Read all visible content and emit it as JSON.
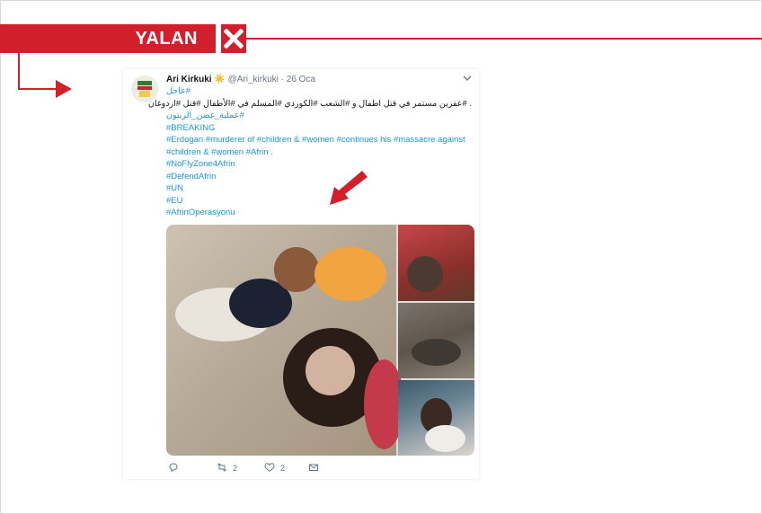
{
  "verdict": {
    "label": "YALAN",
    "icon": "close-icon",
    "color": "#d21f2c"
  },
  "tweet": {
    "author": {
      "display_name": "Ari Kirkuki",
      "emoji": "☀️",
      "handle": "@Ari_kirkuki",
      "separator": "·",
      "date": "26 Oca"
    },
    "body_lines": [
      "#عاجل",
      ". #عفرين مستمر في قتل اطفال و #الشعب #الكوردي #المسلم في #الأطفال #قتل #اردوغان",
      "#عملية_غصن_الزيتون",
      "#BREAKING",
      "#Erdogan #murderer of #children & #women #continues his #massacre against",
      "#children & #women #Afrin .",
      "#NoFlyZone4Afrin",
      "#DefendAfrin",
      "#UN",
      "#EU",
      "#AfrinOperasyonu"
    ],
    "actions": {
      "reply_icon": "reply-icon",
      "retweet_icon": "retweet-icon",
      "retweet_count": "2",
      "like_icon": "heart-icon",
      "like_count": "2",
      "message_icon": "envelope-icon"
    }
  },
  "colors": {
    "accent": "#d21f2c",
    "link": "#1b95e0",
    "muted": "#657786"
  }
}
